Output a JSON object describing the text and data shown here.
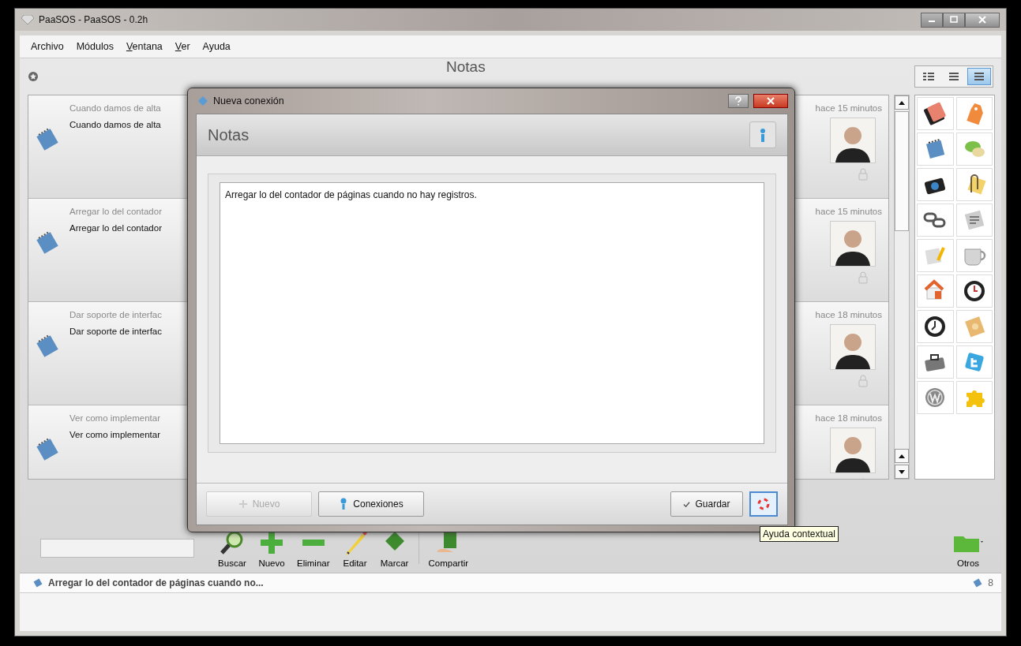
{
  "window": {
    "title": "PaaSOS - PaaSOS - 0.2h"
  },
  "menu": [
    {
      "label": "Archivo",
      "mnemonic": false
    },
    {
      "label": "Módulos",
      "mnemonic": false
    },
    {
      "label": "Ventana",
      "mnemonic": true
    },
    {
      "label": "Ver",
      "mnemonic": true
    },
    {
      "label": "Ayuda",
      "mnemonic": false
    }
  ],
  "header": {
    "title": "Notas",
    "views": [
      {
        "selected": false
      },
      {
        "selected": false
      },
      {
        "selected": true
      }
    ]
  },
  "notes": [
    {
      "summary": "Cuando damos de alta",
      "text": "Cuando damos de alta",
      "time": "hace 15 minutos"
    },
    {
      "summary": "Arregar lo del contador",
      "text": "Arregar lo del contador",
      "time": "hace 15 minutos"
    },
    {
      "summary": "Dar soporte de interfac",
      "text": "Dar soporte de interfac",
      "time": "hace 18 minutos"
    },
    {
      "summary": "Ver como implementar",
      "text": "Ver como implementar",
      "time": "hace 18 minutos"
    }
  ],
  "toolbar": {
    "buttons": [
      "Buscar",
      "Nuevo",
      "Eliminar",
      "Editar",
      "Marcar",
      "Compartir"
    ],
    "other": "Otros"
  },
  "status": {
    "text": "Arregar lo del contador de páginas cuando no...",
    "count": "8"
  },
  "dialog": {
    "title": "Nueva conexión",
    "heading": "Notas",
    "text": "Arregar lo del contador de páginas cuando no hay registros.",
    "buttons": [
      {
        "label": "Nuevo",
        "disabled": true
      },
      {
        "label": "Conexiones",
        "disabled": false
      }
    ],
    "save": "Guardar",
    "help_focused": true,
    "tooltip": "Ayuda contextual"
  }
}
